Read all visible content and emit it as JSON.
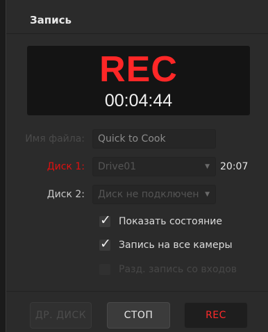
{
  "panel": {
    "title": "Запись"
  },
  "display": {
    "status": "REC",
    "timecode": "00:04:44",
    "status_color": "#ff2727"
  },
  "filename": {
    "label": "Имя файла:",
    "value": "Quick to Cook"
  },
  "disk1": {
    "label": "Диск 1:",
    "value": "Drive01",
    "time_remaining": "20:07",
    "label_color": "#e01010"
  },
  "disk2": {
    "label": "Диск 2:",
    "value": "Диск не подключен"
  },
  "options": {
    "show_status": {
      "label": "Показать состояние",
      "checked": true
    },
    "record_all_cameras": {
      "label": "Запись на все камеры",
      "checked": true
    },
    "split_recording": {
      "label": "Разд. запись со входов",
      "checked": false,
      "disabled": true
    }
  },
  "buttons": {
    "dr_disk": "ДР. ДИСК",
    "stop": "СТОП",
    "rec": "REC"
  }
}
